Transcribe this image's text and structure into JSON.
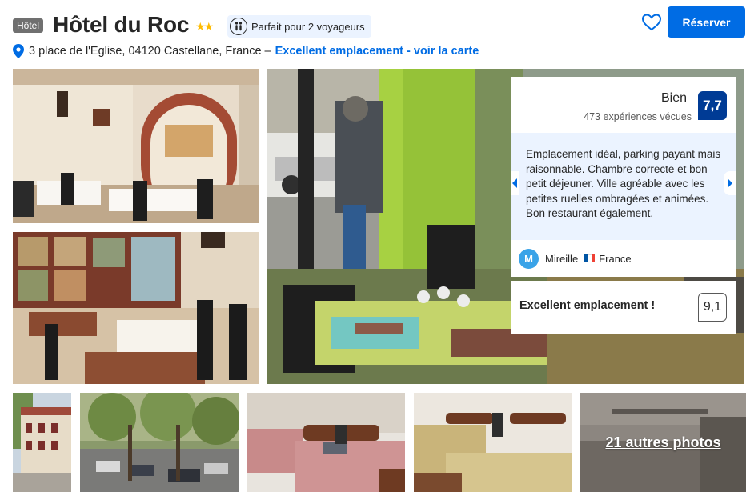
{
  "header": {
    "type_badge": "Hôtel",
    "hotel_name": "Hôtel du Roc",
    "stars": "★★",
    "traveler_badge": "Parfait pour 2 voyageurs",
    "reserve_label": "Réserver",
    "wishlist_icon": "heart-icon",
    "accent_color": "#006ce4"
  },
  "address": {
    "text": "3 place de l'Eglise, 04120 Castellane, France –",
    "link": "Excellent emplacement - voir la carte",
    "icon": "map-pin-icon"
  },
  "review": {
    "rating_word": "Bien",
    "review_count": "473 expériences vécues",
    "score": "7,7",
    "score_color": "#003b95",
    "quote": "Emplacement idéal, parking payant mais raisonnable. Chambre correcte et bon petit déjeuner. Ville agréable avec les petites ruelles ombragées et animées. Bon restaurant également.",
    "author_initial": "M",
    "author_name": "Mireille",
    "author_country": "France",
    "location_label": "Excellent emplacement !",
    "location_score": "9,1"
  },
  "gallery": {
    "more_photos_label": "21 autres photos",
    "photos": [
      "restaurant-entrance",
      "restaurant-dining-room",
      "terrace-with-person",
      "hotel-facade",
      "street-with-cars",
      "bedroom-1",
      "bedroom-2",
      "hallway"
    ]
  }
}
